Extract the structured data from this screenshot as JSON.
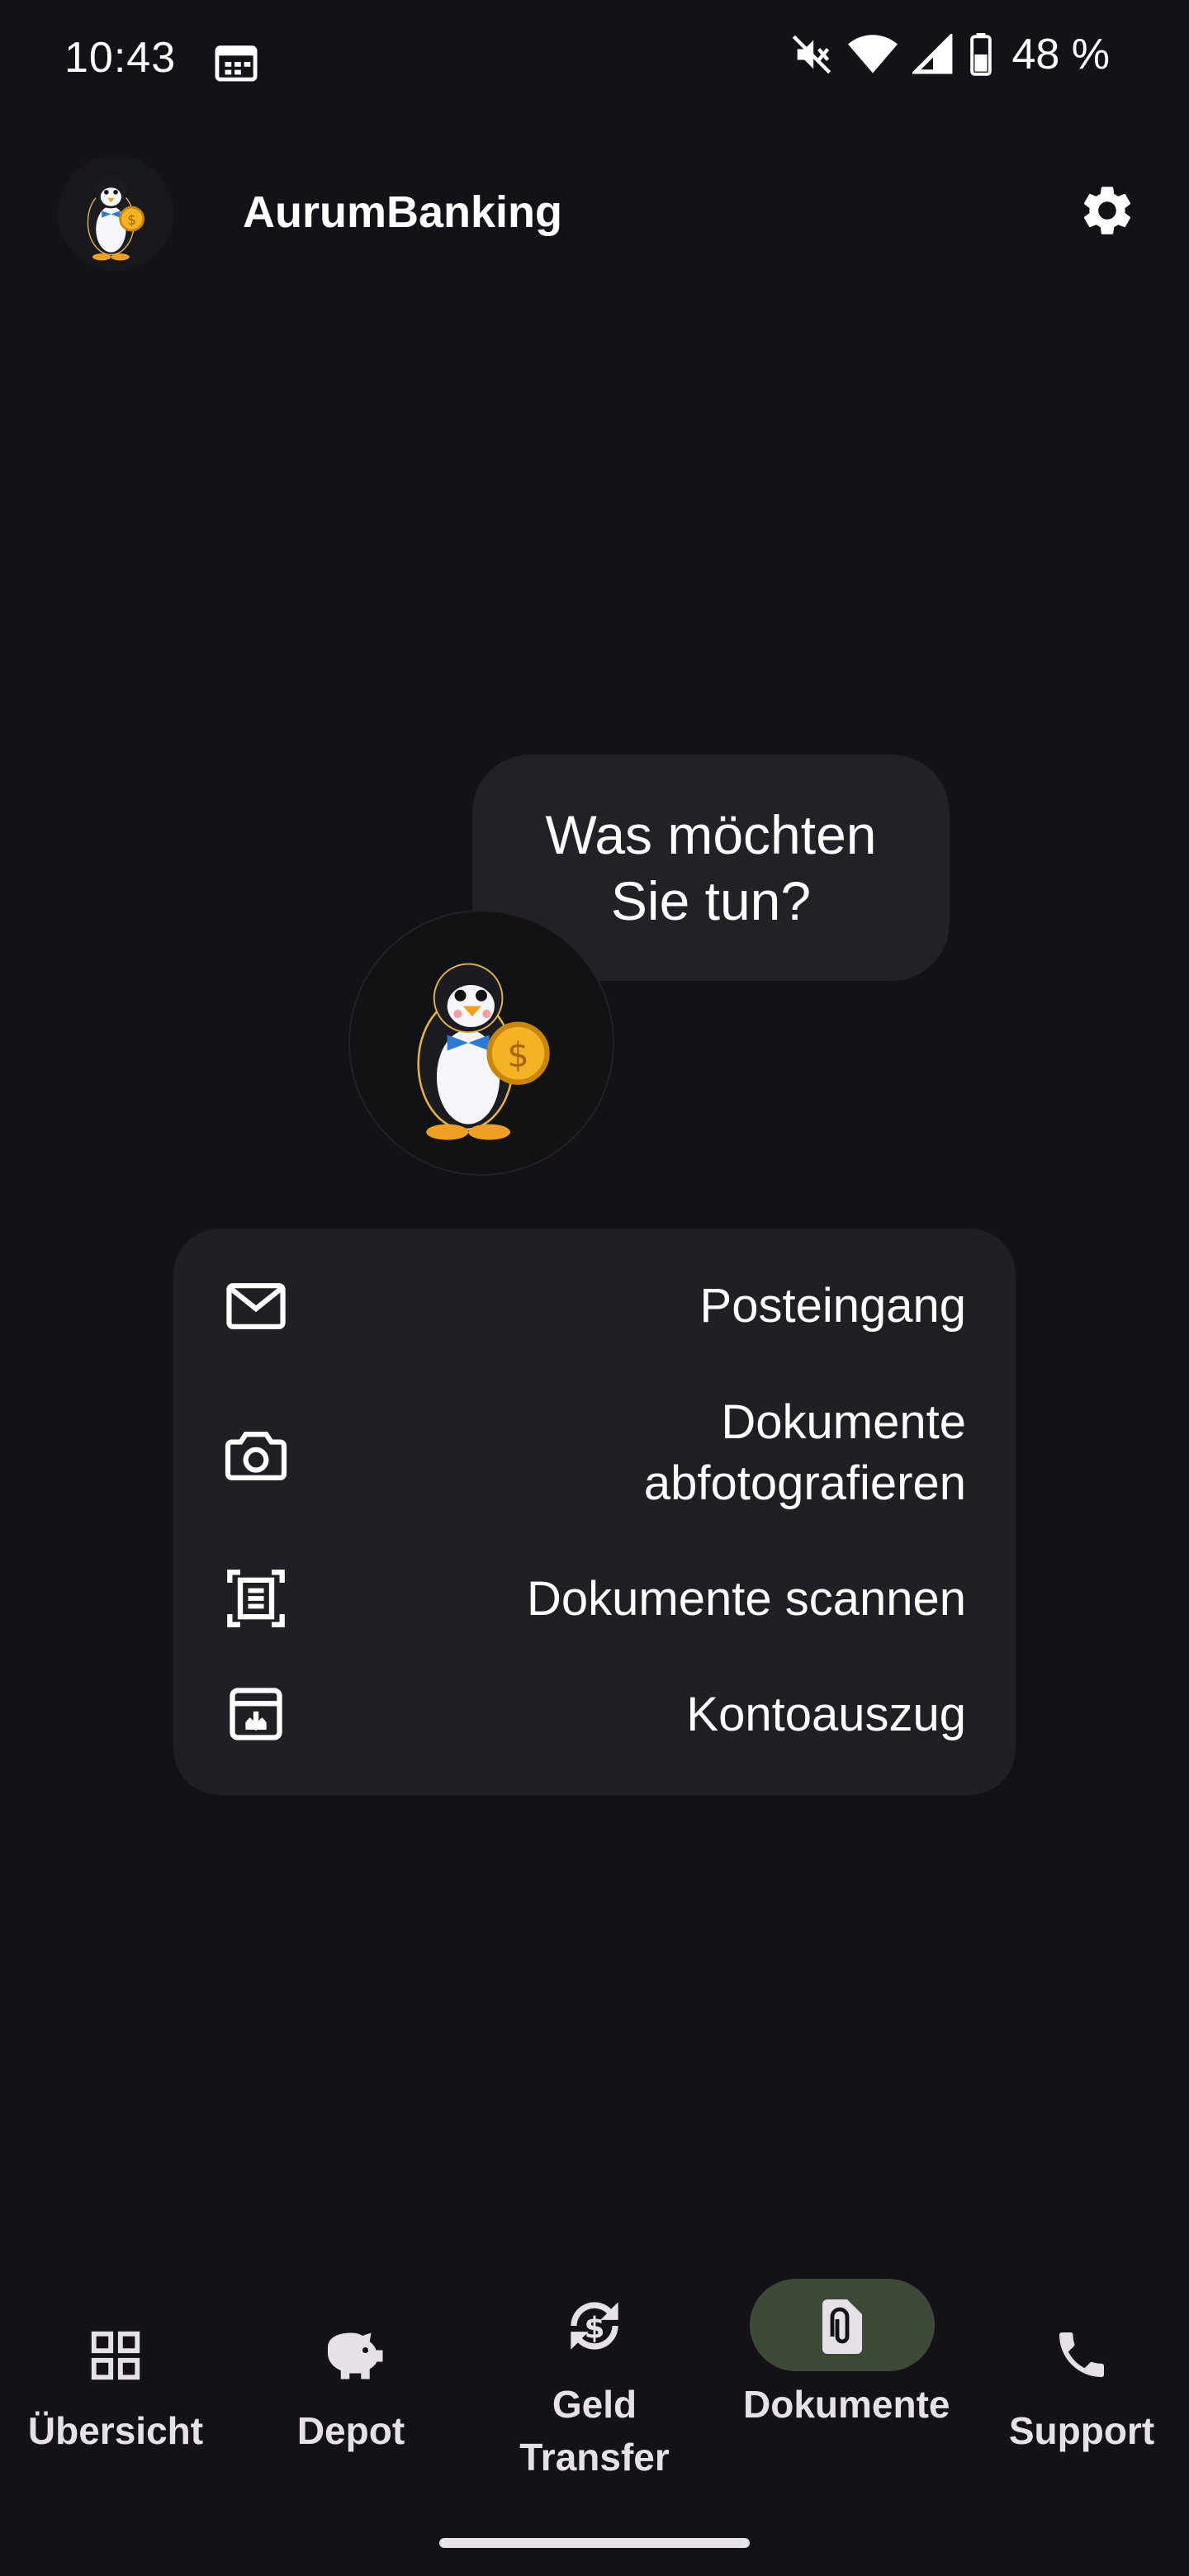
{
  "status_bar": {
    "time": "10:43",
    "battery": "48 %",
    "icons": [
      "calendar-icon",
      "mute-icon",
      "wifi-icon",
      "signal-icon",
      "battery-icon"
    ]
  },
  "app_bar": {
    "title": "AurumBanking",
    "avatar_icon": "penguin-mascot-icon",
    "settings_icon": "gear-icon"
  },
  "bubble": {
    "text": "Was möchten Sie tun?"
  },
  "actions": [
    {
      "label": "Posteingang",
      "icon": "mail-icon"
    },
    {
      "label": "Dokumente abfotografieren",
      "icon": "camera-icon"
    },
    {
      "label": "Dokumente scannen",
      "icon": "document-scan-icon"
    },
    {
      "label": "Kontoauszug",
      "icon": "archive-download-icon"
    }
  ],
  "bottom_nav": {
    "items": [
      {
        "label": "Übersicht",
        "icon": "grid-icon",
        "active": false
      },
      {
        "label": "Depot",
        "icon": "piggy-bank-icon",
        "active": false
      },
      {
        "label": "Geld Transfer",
        "icon": "currency-exchange-icon",
        "active": false
      },
      {
        "label": "Dokumente",
        "icon": "document-attachment-icon",
        "active": true
      },
      {
        "label": "Support",
        "icon": "phone-icon",
        "active": false
      }
    ]
  },
  "colors": {
    "background": "#141218",
    "card": "#211F26",
    "active_pill": "#3C4A36",
    "text": "#FFFFFF"
  }
}
